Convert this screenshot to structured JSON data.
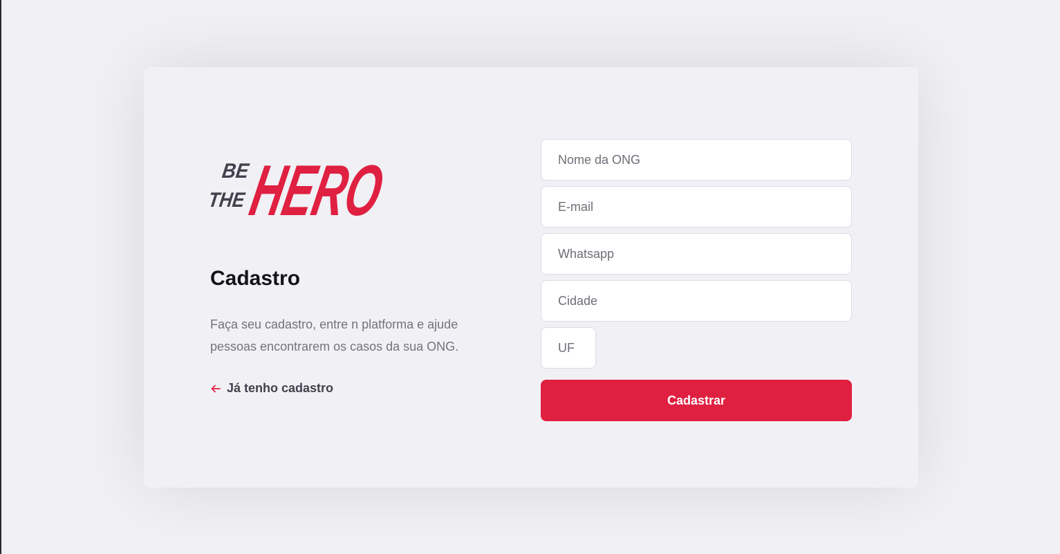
{
  "logo": {
    "line1": "BE",
    "line2": "THE",
    "word": "HERO",
    "dark_color": "#41414d",
    "accent_color": "#e02041"
  },
  "intro": {
    "title": "Cadastro",
    "description": "Faça seu cadastro, entre n platforma e ajude pessoas encontrarem os casos da sua ONG.",
    "back_link_label": "Já tenho cadastro",
    "back_icon": "arrow-left-icon"
  },
  "form": {
    "name_placeholder": "Nome da ONG",
    "name_value": "",
    "email_placeholder": "E-mail",
    "email_value": "",
    "whatsapp_placeholder": "Whatsapp",
    "whatsapp_value": "",
    "city_placeholder": "Cidade",
    "city_value": "",
    "uf_placeholder": "UF",
    "uf_value": "",
    "submit_label": "Cadastrar"
  },
  "colors": {
    "background": "#f0f0f5",
    "accent": "#e02041",
    "text_dark": "#13131a",
    "text_muted": "#737380"
  }
}
